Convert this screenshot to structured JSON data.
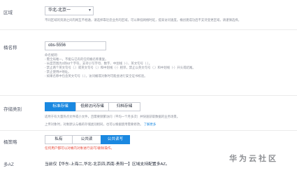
{
  "region": {
    "label": "区域",
    "value": "华北-北京一",
    "hint": "不同区域的资源之间内网互不相通，请选择靠近您业务的区域，可以降低网络时延，提高访问速度。桶创建成功后不支持变更区域，请谨慎选择。"
  },
  "bucket_name": {
    "label": "桶名称",
    "value": "obs-5556",
    "rules_title": "命名规则：",
    "rules": [
      "- 需全局唯一，不能与已有的任何桶名称重复。",
      "- 长度范围为3到63个字符，支持小写字母、数字、中划线（-）、英文句号（.）。",
      "- 禁止两个英文句号（.）或英文句号（.）和中划线（-）相邻，禁止以英文句号（.）和中划线（-）开头或结尾。",
      "- 禁止使用IP地址。",
      "- 如果名称中包含英文句号（.），访问桶或对象时可能会进行安全证书校验。"
    ]
  },
  "storage_class": {
    "label": "存储类别",
    "options": [
      "标准存储",
      "低频访问存储",
      "归档存储"
    ],
    "selected_index": 0,
    "hint1": "适用于有大量热点文件或小文件，且需要频繁访问（平均一个月多次）并快速获取数据的业务场景。",
    "hint2": "上传对象时，对象默认与桶的存储类别相同，也可以根据使用需要修改。",
    "link": "了解更多"
  },
  "bucket_policy": {
    "label": "桶策略",
    "options": [
      "私有",
      "公共读",
      "公共读写"
    ],
    "selected_index": 2,
    "warning": "任何用户都可以对桶内对象进行读/写/删除操作。"
  },
  "multi_az": {
    "label": "多AZ",
    "text": "当前仅【华东-上海二,华北-北京四,西南-贵阳一】区域支持配置多AZ。"
  },
  "watermark": "华为云社区",
  "colors": {
    "accent": "#1a88e0",
    "warning": "#e84c3d"
  }
}
